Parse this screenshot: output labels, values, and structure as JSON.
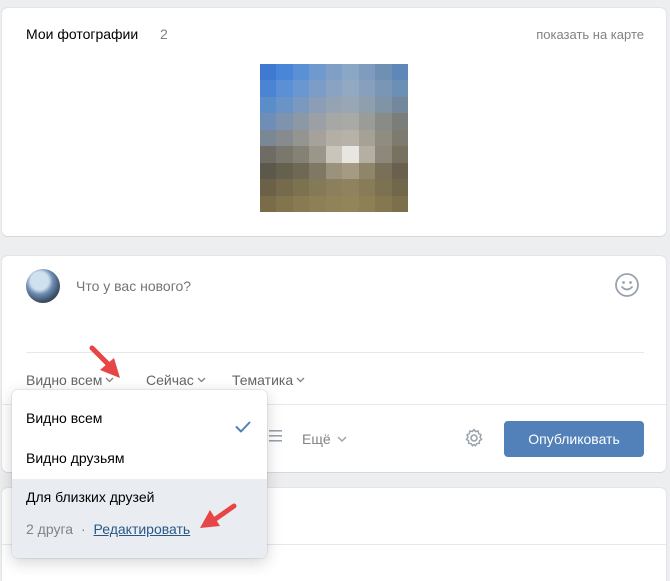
{
  "photos": {
    "title": "Мои фотографии",
    "count": "2",
    "show_on_map": "показать на карте"
  },
  "composer": {
    "placeholder": "Что у вас нового?",
    "options": {
      "visibility": "Видно всем",
      "time": "Сейчас",
      "topic": "Тематика"
    },
    "more_label": "Ещё",
    "publish_label": "Опубликовать"
  },
  "visibility_menu": {
    "items": [
      {
        "label": "Видно всем",
        "selected": true
      },
      {
        "label": "Видно друзьям",
        "selected": false
      },
      {
        "label": "Для близких друзей",
        "selected": false
      }
    ],
    "close_friends_count": "2 друга",
    "separator": "·",
    "edit_label": "Редактировать"
  },
  "colors": {
    "accent": "#5181b8",
    "link": "#2a5885",
    "arrow": "#e64646",
    "background": "#edeef0"
  },
  "icons": [
    "smile-icon",
    "chevron-down-icon",
    "list-icon",
    "gear-icon",
    "check-icon",
    "arrow-pointer-icon"
  ]
}
